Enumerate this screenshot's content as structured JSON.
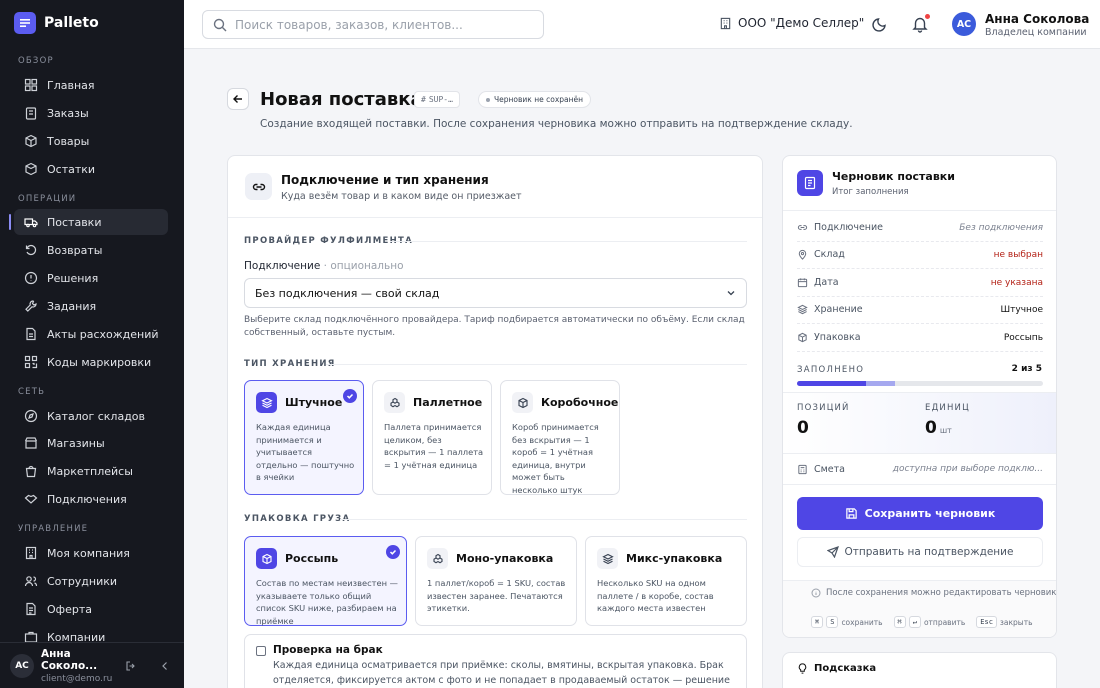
{
  "app": {
    "name": "Palleto"
  },
  "sidebar": {
    "sections": [
      {
        "label": "ОБЗОР",
        "items": [
          {
            "label": "Главная"
          },
          {
            "label": "Заказы"
          },
          {
            "label": "Товары"
          },
          {
            "label": "Остатки"
          }
        ]
      },
      {
        "label": "ОПЕРАЦИИ",
        "items": [
          {
            "label": "Поставки",
            "active": true
          },
          {
            "label": "Возвраты"
          },
          {
            "label": "Решения"
          },
          {
            "label": "Задания"
          },
          {
            "label": "Акты расхождений"
          },
          {
            "label": "Коды маркировки"
          }
        ]
      },
      {
        "label": "СЕТЬ",
        "items": [
          {
            "label": "Каталог складов"
          },
          {
            "label": "Магазины"
          },
          {
            "label": "Маркетплейсы"
          },
          {
            "label": "Подключения"
          }
        ]
      },
      {
        "label": "УПРАВЛЕНИЕ",
        "items": [
          {
            "label": "Моя компания"
          },
          {
            "label": "Сотрудники"
          },
          {
            "label": "Оферта"
          },
          {
            "label": "Компании"
          }
        ]
      }
    ],
    "user": {
      "initials": "AC",
      "name": "Анна Соколо...",
      "email": "client@demo.ru"
    }
  },
  "topbar": {
    "search_placeholder": "Поиск товаров, заказов, клиентов...",
    "org": "ООО \"Демо Селлер\"",
    "user_initials": "AC",
    "user_name": "Анна Соколова",
    "user_role": "Владелец компании"
  },
  "page": {
    "title": "Новая поставка",
    "code": "SUP-…",
    "status": "Черновик не сохранён",
    "subtitle": "Создание входящей поставки. После сохранения черновика можно отправить на подтверждение складу."
  },
  "form": {
    "title": "Подключение и тип хранения",
    "subtitle": "Куда везём товар и в каком виде он приезжает",
    "provider_section": "ПРОВАЙДЕР ФУЛФИЛМЕНТА",
    "connection_label": "Подключение",
    "connection_optional": "· опционально",
    "connection_value": "Без подключения — свой склад",
    "connection_help": "Выберите склад подключённого провайдера. Тариф подбирается автоматически по объёму. Если склад собственный, оставьте пустым.",
    "storage_section": "ТИП ХРАНЕНИЯ",
    "storage_options": [
      {
        "title": "Штучное",
        "desc": "Каждая единица принимается и учитывается отдельно — поштучно в ячейки",
        "selected": true
      },
      {
        "title": "Паллетное",
        "desc": "Паллета принимается целиком, без вскрытия — 1 паллета = 1 учётная единица",
        "selected": false
      },
      {
        "title": "Коробочное",
        "desc": "Короб принимается без вскрытия — 1 короб = 1 учётная единица, внутри может быть несколько штук",
        "selected": false
      }
    ],
    "packing_section": "УПАКОВКА ГРУЗА",
    "packing_options": [
      {
        "title": "Россыпь",
        "desc": "Состав по местам неизвестен — указываете только общий список SKU ниже, разбираем на приёмке",
        "selected": true
      },
      {
        "title": "Моно-упаковка",
        "desc": "1 паллет/короб = 1 SKU, состав известен заранее. Печатаются этикетки.",
        "selected": false
      },
      {
        "title": "Микс-упаковка",
        "desc": "Несколько SKU на одном паллете / в коробе, состав каждого места известен",
        "selected": false
      }
    ],
    "qc_title": "Проверка на брак",
    "qc_desc": "Каждая единица осматривается при приёмке: сколы, вмятины, вскрытая упаковка. Брак отделяется, фиксируется актом с фото и не попадает в продаваемый остаток — решение по нему принимаете во"
  },
  "summary": {
    "title": "Черновик поставки",
    "subtitle": "Итог заполнения",
    "rows": [
      {
        "label": "Подключение",
        "value": "Без подключения",
        "tone": "muted"
      },
      {
        "label": "Склад",
        "value": "не выбран",
        "tone": "red"
      },
      {
        "label": "Дата",
        "value": "не указана",
        "tone": "red"
      },
      {
        "label": "Хранение",
        "value": "Штучное",
        "tone": "dark"
      },
      {
        "label": "Упаковка",
        "value": "Россыпь",
        "tone": "dark"
      }
    ],
    "fill_label": "ЗАПОЛНЕНО",
    "fill_value": "2 из 5",
    "fill_fraction": 0.4,
    "positions_label": "ПОЗИЦИЙ",
    "positions_value": "0",
    "units_label": "ЕДИНИЦ",
    "units_value": "0",
    "units_unit": "шт",
    "estimate_label": "Смета",
    "estimate_value": "доступна при выборе подклю...",
    "save_label": "Сохранить черновик",
    "send_label": "Отправить на подтверждение",
    "note": "После сохранения можно редактировать черновик",
    "shortcuts": [
      {
        "keys": [
          "⌘",
          "S"
        ],
        "label": "сохранить"
      },
      {
        "keys": [
          "⌘",
          "↵"
        ],
        "label": "отправить"
      },
      {
        "keys": [
          "Esc"
        ],
        "label": "закрыть"
      }
    ]
  },
  "hint": {
    "title": "Подсказка"
  },
  "colors": {
    "accent": "#4f46e5",
    "sidebar": "#16181f",
    "danger": "#b42318"
  }
}
